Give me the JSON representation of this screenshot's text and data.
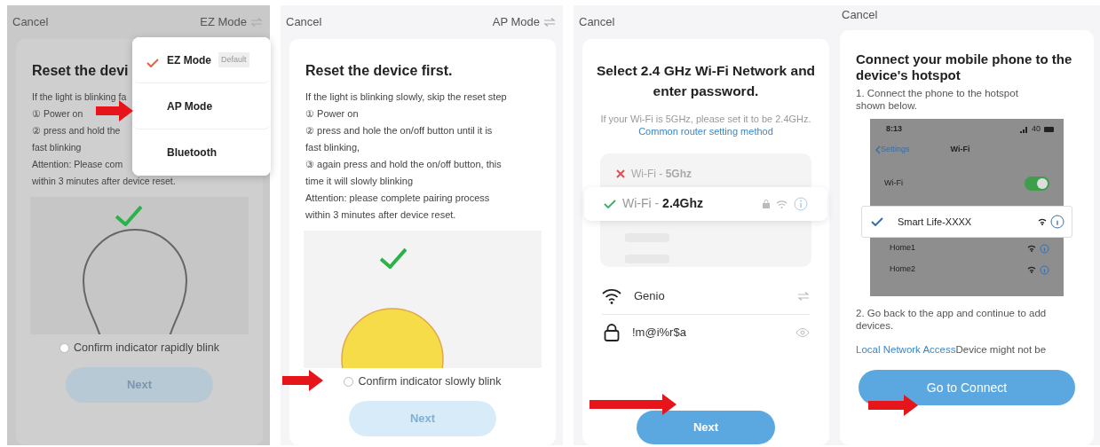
{
  "screens": [
    {
      "kind": "reset",
      "dimmed": true,
      "cancel": "Cancel",
      "mode": "EZ Mode",
      "title": "Reset the devi",
      "lines": [
        "If the light is blinking fa",
        "① Power on",
        "② press and hold the",
        "fast blinking",
        "Attention: Please com",
        "within 3 minutes after device reset."
      ],
      "bulb_lit": false,
      "confirm": {
        "label": "Confirm indicator rapidly blink",
        "checked": false
      },
      "next": {
        "label": "Next",
        "disabled": true
      },
      "menu": {
        "items": [
          {
            "label": "EZ Mode",
            "selected": true,
            "badge": "Default"
          },
          {
            "label": "AP Mode",
            "selected": false
          },
          {
            "label": "Bluetooth",
            "selected": false
          }
        ]
      }
    },
    {
      "kind": "reset",
      "dimmed": false,
      "cancel": "Cancel",
      "mode": "AP Mode",
      "title": "Reset the device first.",
      "lines": [
        "If the light is blinking slowly, skip the reset step",
        "① Power on",
        "② press and hole the on/off button until it is",
        "fast blinking,",
        "③ again press and hold the on/off button, this",
        "time it will slowly blinking",
        "Attention: please complete pairing process",
        "within 3 minutes after device reset."
      ],
      "bulb_lit": true,
      "confirm": {
        "label": "Confirm indicator slowly blink",
        "checked": false
      },
      "next": {
        "label": "Next",
        "disabled": true
      }
    },
    {
      "kind": "wifi",
      "cancel": "Cancel",
      "title": "Select 2.4 GHz Wi-Fi Network and enter password.",
      "hint": "If your Wi-Fi is 5GHz, please set it to be 2.4GHz.",
      "hint_link": "Common router setting method",
      "networks": [
        {
          "name": "Wi-Fi - **5Ghz**",
          "selected": false
        },
        {
          "name": "Wi-Fi - **2.4Ghz**",
          "selected": true
        }
      ],
      "ssid": "Genio",
      "password": "!m@i%r$a",
      "next": {
        "label": "Next",
        "disabled": false
      }
    },
    {
      "kind": "hotspot",
      "cancel": "Cancel",
      "title": "Connect your mobile phone to the device's hotspot",
      "step1": "1. Connect the phone to the hotspot shown below.",
      "phone": {
        "time": "8:13",
        "signal": "40",
        "back": "Settings",
        "heading": "Wi-Fi",
        "wifi_label": "Wi-Fi",
        "wifi_on": true,
        "networks": [
          {
            "name": "Smart Life-XXXX",
            "selected": true
          },
          {
            "name": "Home1",
            "selected": false
          },
          {
            "name": "Home2",
            "selected": false
          }
        ]
      },
      "step2": "2. Go back to the app and continue to add devices.",
      "link": "Local Network Access",
      "note": "Device might not be",
      "button": "Go to Connect"
    }
  ]
}
